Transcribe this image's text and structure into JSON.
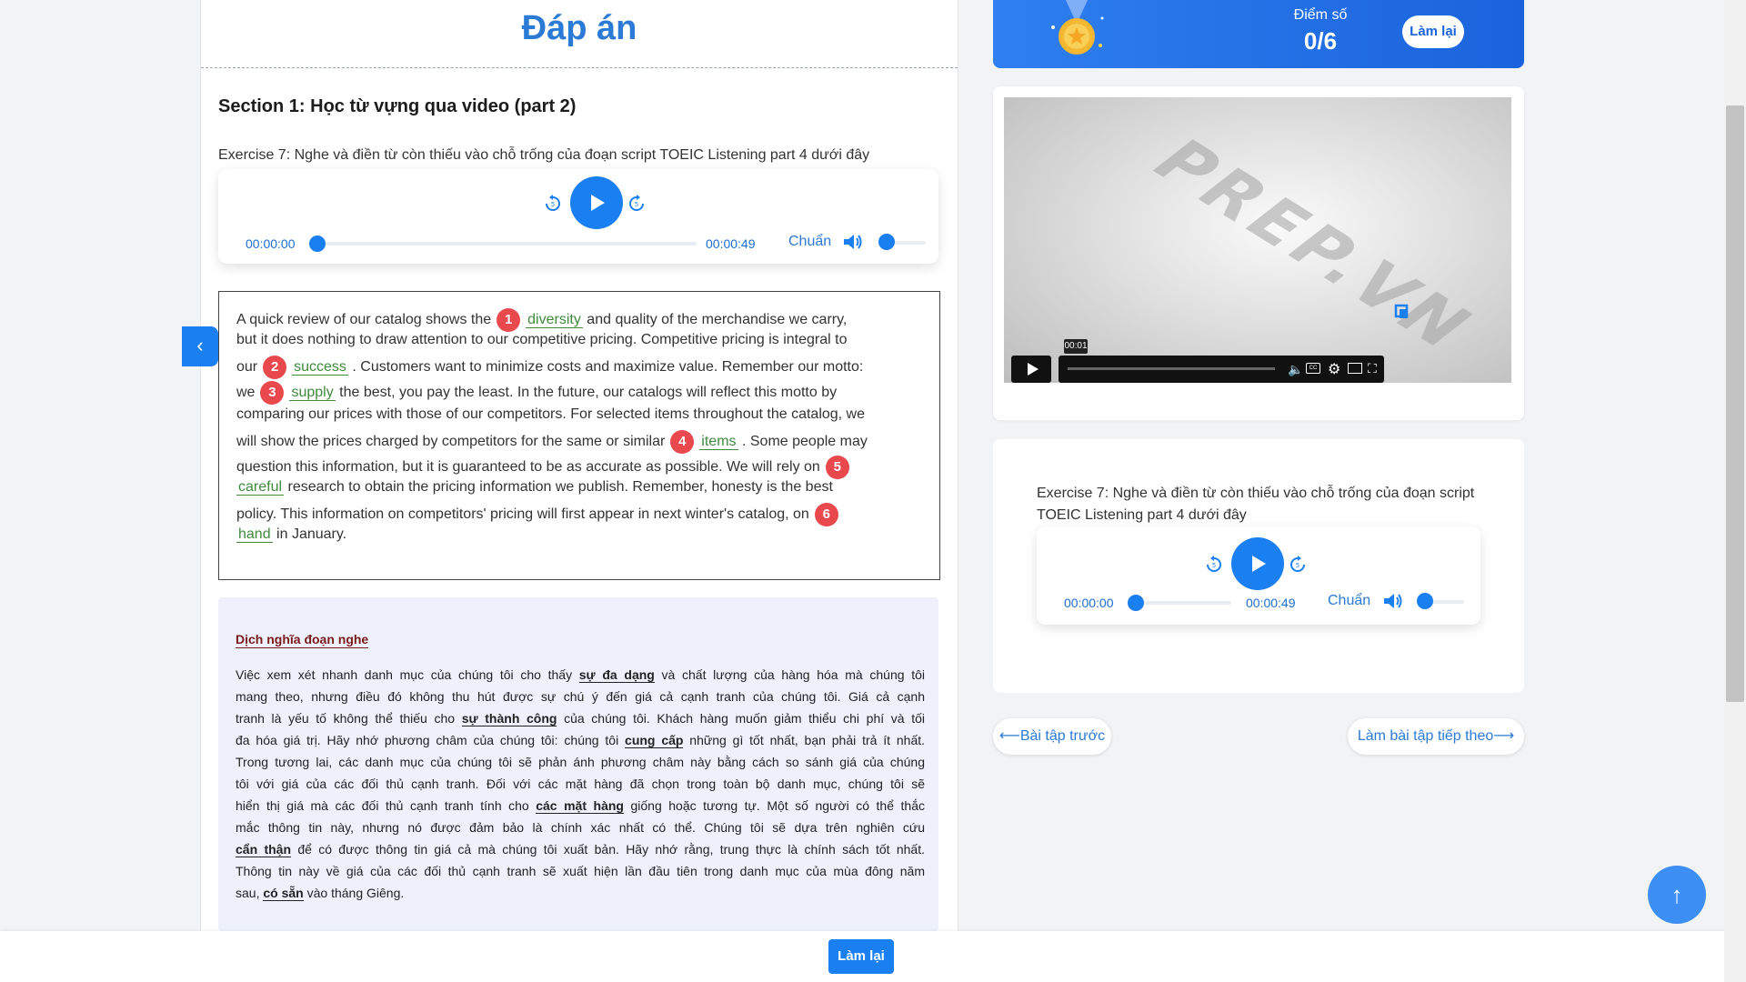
{
  "page_title": "Đáp án",
  "section_title": "Section 1: Học từ vựng qua video (part 2)",
  "exercise_label": "Exercise 7: Nghe và điền từ còn thiếu vào chỗ trống của đoạn script TOEIC Listening part 4 dưới đây",
  "audio_player": {
    "current_time": "00:00:00",
    "duration": "00:00:49",
    "speed_label": "Chuẩn",
    "progress_fraction": 0.0
  },
  "passage": {
    "lines": [
      {
        "pre": "A quick review of our catalog shows the",
        "num": "1",
        "ans": "diversity",
        "post": "and quality of the merchandise we carry,"
      },
      {
        "pre": "but it does nothing to draw attention to our competitive pricing. Competitive pricing is integral to"
      },
      {
        "pre": "our",
        "num": "2",
        "ans": "success",
        "post": ". Customers want to minimize costs and maximize value. Remember our motto:"
      },
      {
        "pre": "we",
        "num": "3",
        "ans": "supply",
        "post": "the best, you pay the least. In the future, our catalogs will reflect this motto by"
      },
      {
        "pre": "comparing our prices with those of our competitors. For selected items throughout the catalog, we"
      },
      {
        "pre": "will show the prices charged by competitors for the same or similar",
        "num": "4",
        "ans": "items",
        "post": ". Some people may"
      },
      {
        "pre": "question this information, but it is guaranteed to be as accurate as possible. We will rely on",
        "num": "5"
      },
      {
        "ans": "careful",
        "post": "research to obtain the pricing information we publish. Remember, honesty is the best"
      },
      {
        "pre": "policy. This information on competitors' pricing will first appear in next winter's catalog, on",
        "num": "6"
      },
      {
        "ans": "hand",
        "post": "in January."
      }
    ]
  },
  "translation": {
    "heading": "Dịch nghĩa đoạn nghe",
    "lines": [
      {
        "pre": "Việc xem xét nhanh danh mục của chúng tôi cho thấy ",
        "kw": "sự đa dạng",
        "post": " và chất lượng của hàng hóa mà chúng tôi"
      },
      {
        "pre": "mang theo, nhưng điều đó không thu hút được sự chú ý đến giá cả cạnh tranh của chúng tôi. Giá cả cạnh"
      },
      {
        "pre": "tranh là yếu tố không thể thiếu cho ",
        "kw": "sự thành công",
        "post": " của chúng tôi. Khách hàng muốn giảm thiểu chi phí và tối"
      },
      {
        "pre": "đa hóa giá trị. Hãy nhớ phương châm của chúng tôi: chúng tôi ",
        "kw": "cung cấp",
        "post": " những gì tốt nhất, bạn phải trả ít nhất."
      },
      {
        "pre": "Trong tương lai, các danh mục của chúng tôi sẽ phản ánh phương châm này bằng cách so sánh giá của chúng"
      },
      {
        "pre": "tôi với giá của các đối thủ cạnh tranh. Đối với các mặt hàng đã chọn trong toàn bộ danh mục, chúng tôi sẽ"
      },
      {
        "pre": "hiển thị giá mà các đối thủ cạnh tranh tính cho ",
        "kw": "các mặt hàng",
        "post": " giống hoặc tương tự. Một số người có thể thắc"
      },
      {
        "pre": "mắc thông tin này, nhưng nó được đảm bảo là chính xác nhất có thể. Chúng tôi sẽ dựa trên nghiên cứu"
      },
      {
        "kw": "cẩn thận",
        "post": " để có được thông tin giá cả mà chúng tôi xuất bản. Hãy nhớ rằng, trung thực là chính sách tốt nhất."
      },
      {
        "pre": "Thông tin này về giá của các đối thủ cạnh tranh sẽ xuất hiện lần đầu tiên trong danh mục của mùa đông năm"
      },
      {
        "pre": "sau, ",
        "kw": "có sẵn",
        "post": " vào tháng Giêng."
      }
    ]
  },
  "score": {
    "label": "Điểm số",
    "value": "0/6",
    "redo_label": "Làm lại"
  },
  "video": {
    "watermark": "PREP.VN",
    "tooltip_time": "00:01",
    "progress_fraction": 0.0
  },
  "right_exercise": {
    "text": "Exercise 7: Nghe và điền từ còn thiếu vào chỗ trống của đoạn script TOEIC Listening part 4 dưới đây",
    "current_time": "00:00:00",
    "duration": "00:00:49",
    "speed_label": "Chuẩn"
  },
  "nav": {
    "prev_label": "Bài tập trước",
    "next_label": "Làm bài tập tiếp theo"
  },
  "bottom": {
    "redo_label": "Làm lại"
  },
  "icons": {
    "play": "play-icon",
    "rewind": "rewind-icon",
    "forward": "forward-icon",
    "volume": "volume-icon",
    "medal": "medal-icon",
    "back_to_top": "arrow-up-icon",
    "toggle": "chevron-left-icon"
  },
  "colors": {
    "accent": "#1a7ff0",
    "title": "#2b7bd6",
    "answer": "#3f8a3d",
    "number_badge": "#e9484d"
  }
}
